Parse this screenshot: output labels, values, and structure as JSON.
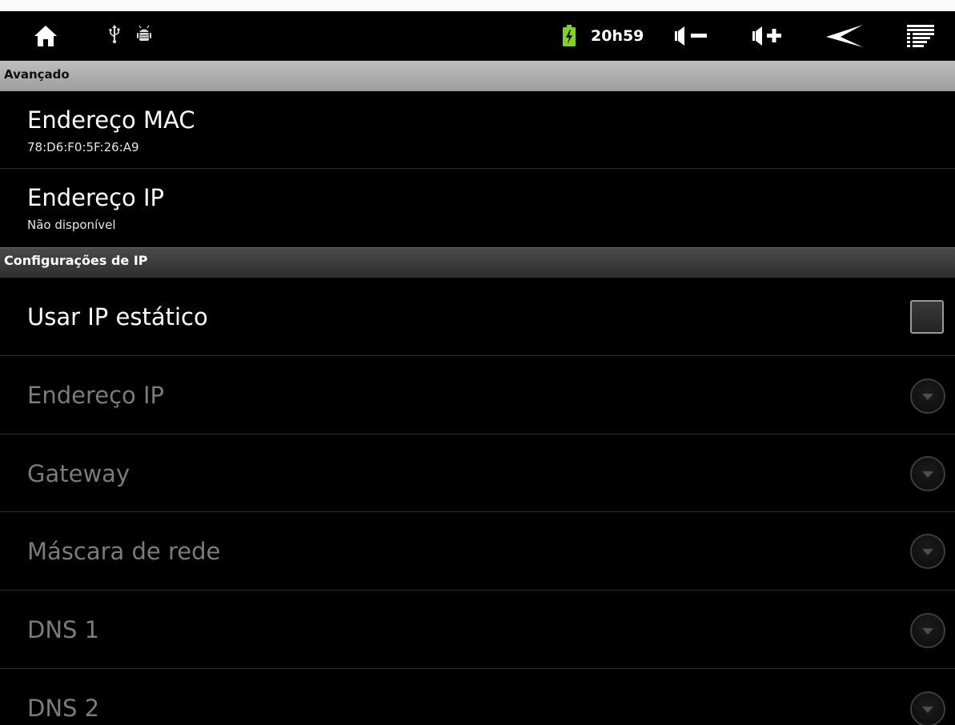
{
  "statusbar": {
    "time": "20h59",
    "icons": [
      "home-icon",
      "usb-icon",
      "android-debug-icon",
      "battery-charging-icon",
      "volume-down-icon",
      "volume-up-icon",
      "back-icon",
      "menu-icon"
    ]
  },
  "sections": {
    "advanced": "Avançado",
    "ip_settings": "Configurações de IP"
  },
  "mac": {
    "title": "Endereço MAC",
    "summary": "78:D6:F0:5F:26:A9"
  },
  "ip_info": {
    "title": "Endereço IP",
    "summary": "Não disponível"
  },
  "static_ip": {
    "title": "Usar IP estático",
    "checked": false
  },
  "fields": [
    {
      "title": "Endereço IP"
    },
    {
      "title": "Gateway"
    },
    {
      "title": "Máscara de rede"
    },
    {
      "title": "DNS 1"
    },
    {
      "title": "DNS 2"
    }
  ],
  "colors": {
    "background": "#000000",
    "battery": "#7fd321",
    "disabled_text": "#7b7b7b"
  }
}
